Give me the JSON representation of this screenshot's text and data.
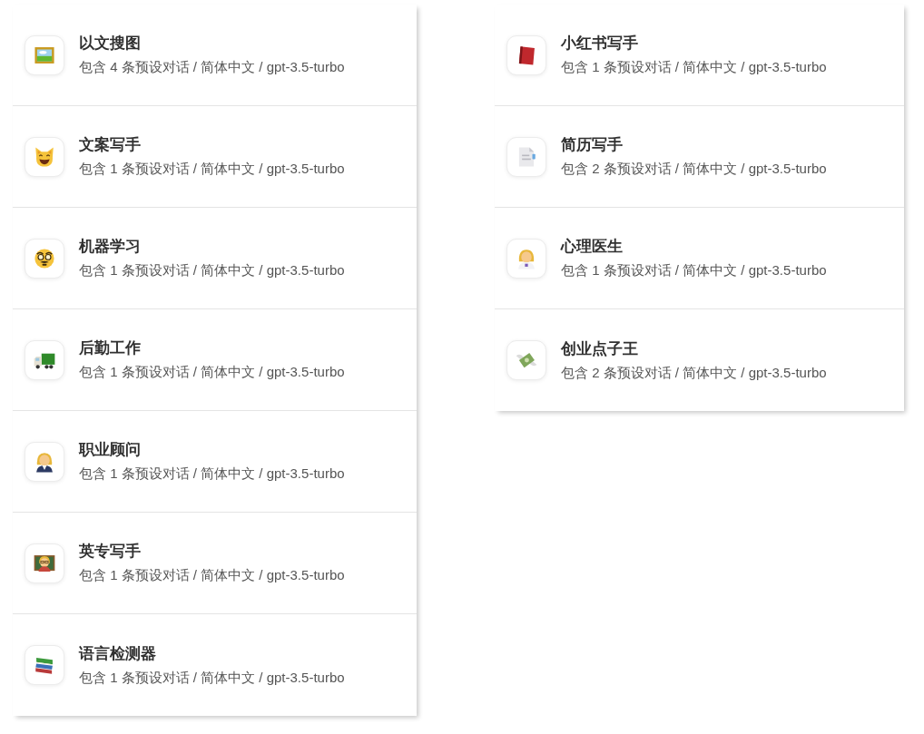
{
  "columns": [
    {
      "items": [
        {
          "title": "以文搜图",
          "subtitle": "包含 4 条预设对话 / 简体中文 / gpt-3.5-turbo"
        },
        {
          "title": "文案写手",
          "subtitle": "包含 1 条预设对话 / 简体中文 / gpt-3.5-turbo"
        },
        {
          "title": "机器学习",
          "subtitle": "包含 1 条预设对话 / 简体中文 / gpt-3.5-turbo"
        },
        {
          "title": "后勤工作",
          "subtitle": "包含 1 条预设对话 / 简体中文 / gpt-3.5-turbo"
        },
        {
          "title": "职业顾问",
          "subtitle": "包含 1 条预设对话 / 简体中文 / gpt-3.5-turbo"
        },
        {
          "title": "英专写手",
          "subtitle": "包含 1 条预设对话 / 简体中文 / gpt-3.5-turbo"
        },
        {
          "title": "语言检测器",
          "subtitle": "包含 1 条预设对话 / 简体中文 / gpt-3.5-turbo"
        }
      ]
    },
    {
      "items": [
        {
          "title": "小红书写手",
          "subtitle": "包含 1 条预设对话 / 简体中文 / gpt-3.5-turbo"
        },
        {
          "title": "简历写手",
          "subtitle": "包含 2 条预设对话 / 简体中文 / gpt-3.5-turbo"
        },
        {
          "title": "心理医生",
          "subtitle": "包含 1 条预设对话 / 简体中文 / gpt-3.5-turbo"
        },
        {
          "title": "创业点子王",
          "subtitle": "包含 2 条预设对话 / 简体中文 / gpt-3.5-turbo"
        }
      ]
    }
  ]
}
